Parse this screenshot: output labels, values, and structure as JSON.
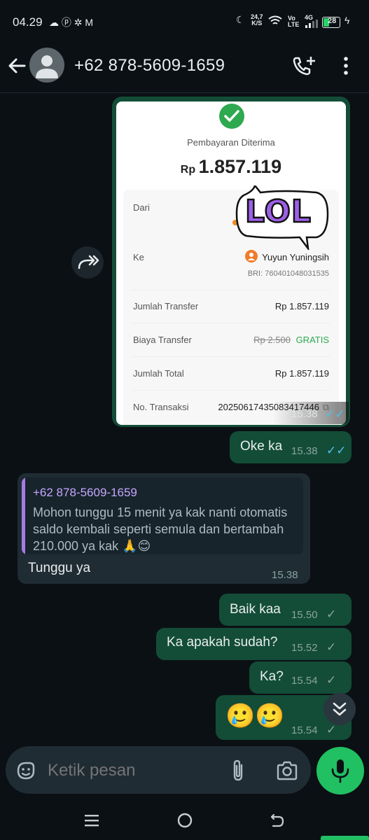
{
  "status_bar": {
    "time": "04.29",
    "speed": "24,7",
    "speed_unit": "K/S",
    "volte": "Vo LTE",
    "network": "4G",
    "battery": "28"
  },
  "header": {
    "contact": "+62 878-5609-1659"
  },
  "receipt": {
    "title": "Pembayaran Diterima",
    "currency": "Rp",
    "amount": "1.857.119",
    "sticker": "LOL",
    "from_label": "Dari",
    "to_label": "Ke",
    "to_name": "Yuyun Yuningsih",
    "to_account": "BRI: 760401048031535",
    "transfer_label": "Jumlah Transfer",
    "transfer_value": "Rp 1.857.119",
    "fee_label": "Biaya Transfer",
    "fee_old": "Rp 2.500",
    "fee_new": "GRATIS",
    "total_label": "Jumlah Total",
    "total_value": "Rp 1.857.119",
    "txn_label": "No. Transaksi",
    "txn_value": "20250617435083417446",
    "time": "15.38"
  },
  "messages": {
    "m1_text": "Oke ka",
    "m1_time": "15.38",
    "reply_sender": "+62 878-5609-1659",
    "reply_quote": "Mohon tunggu 15 menit ya kak nanti otomatis saldo kembali seperti semula dan bertambah 210.000 ya kak 🙏😊",
    "m2_text": "Tunggu ya",
    "m2_time": "15.38",
    "m3_text": "Baik kaa",
    "m3_time": "15.50",
    "m4_text": "Ka apakah sudah?",
    "m4_time": "15.52",
    "m5_text": "Ka?",
    "m5_time": "15.54",
    "m6_text": "🥲🥲",
    "m6_time": "15.54"
  },
  "composer": {
    "placeholder": "Ketik pesan"
  },
  "colors": {
    "background": "#0b1014",
    "outgoing": "#134d37",
    "incoming": "#1f2c34",
    "accent": "#21c063",
    "read_tick": "#53bdeb"
  }
}
